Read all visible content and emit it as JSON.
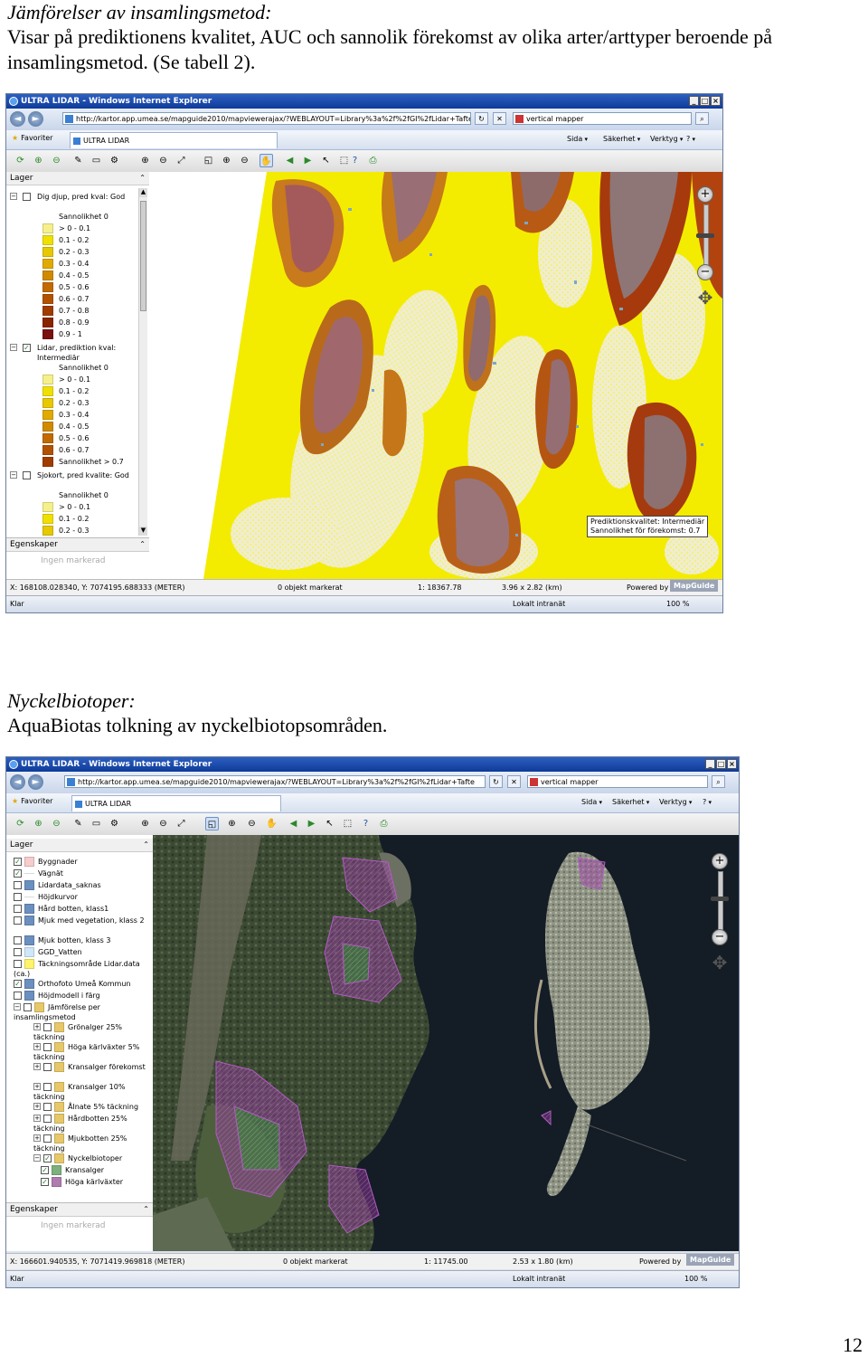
{
  "section1": {
    "heading": "Jämförelser av insamlingsmetod:",
    "line1": "Visar på prediktionens kvalitet, AUC och sannolik förekomst av olika arter/arttyper beroende på",
    "line2": "insamlingsmetod. (Se tabell 2)."
  },
  "section2": {
    "heading": "Nyckelbiotoper:",
    "line1": "AquaBiotas tolkning av nyckelbiotopsområden."
  },
  "page_number": "12",
  "screenshot1": {
    "window_title": "ULTRA LIDAR - Windows Internet Explorer",
    "url": "http://kartor.app.umea.se/mapguide2010/mapviewerajax/?WEBLAYOUT=Library%3a%2f%2fGI%2fLidar+Tafte",
    "search_value": "vertical mapper",
    "fav_label": "Favoriter",
    "tab_label": "ULTRA LIDAR",
    "cmd_sida": "Sida",
    "cmd_sakerhet": "Säkerhet",
    "cmd_verktyg": "Verktyg",
    "layers_title": "Lager",
    "props_title": "Egenskaper",
    "props_empty": "Ingen markerad",
    "groups": [
      {
        "title": "Dig djup, pred kval: God",
        "sub": "Sannolikhet 0",
        "items": [
          "> 0 - 0.1",
          "0.1 - 0.2",
          "0.2 - 0.3",
          "0.3 - 0.4",
          "0.4 - 0.5",
          "0.5 - 0.6",
          "0.6 - 0.7",
          "0.7 - 0.8",
          "0.8 - 0.9",
          "0.9 - 1"
        ]
      },
      {
        "title": "Lidar, prediktion kval: Intermediär",
        "sub": "Sannolikhet 0",
        "items": [
          "> 0 - 0.1",
          "0.1 - 0.2",
          "0.2 - 0.3",
          "0.3 - 0.4",
          "0.4 - 0.5",
          "0.5 - 0.6",
          "0.6 - 0.7",
          "Sannolikhet > 0.7"
        ]
      },
      {
        "title": "Sjokort, pred kvalite: God",
        "sub": "Sannolikhet 0",
        "items": [
          "> 0 - 0.1",
          "0.1 - 0.2",
          "0.2 - 0.3"
        ]
      }
    ],
    "info_line1": "Prediktionskvalitet: Intermediär",
    "info_line2": "Sannolikhet för förekomst: 0.7",
    "coords": "X: 168108.028340, Y: 7074195.688333 (METER)",
    "selected": "0 objekt markerat",
    "scale": "1: 18367.78",
    "extent": "3.96 x 2.82 (km)",
    "powered": "Powered by",
    "mapguide": "MapGuide",
    "status_left": "Klar",
    "zone": "Lokalt intranät",
    "zoom": "100 %",
    "legend_colors": [
      "#f5f08a",
      "#f0e000",
      "#e8c800",
      "#e0aa00",
      "#d08a00",
      "#c26a00",
      "#b25200",
      "#a03c00",
      "#8a2400",
      "#7a1010"
    ]
  },
  "screenshot2": {
    "window_title": "ULTRA LIDAR - Windows Internet Explorer",
    "url": "http://kartor.app.umea.se/mapguide2010/mapviewerajax/?WEBLAYOUT=Library%3a%2f%2fGI%2fLidar+Tafte",
    "search_value": "vertical mapper",
    "fav_label": "Favoriter",
    "tab_label": "ULTRA LIDAR",
    "cmd_sida": "Sida",
    "cmd_sakerhet": "Säkerhet",
    "cmd_verktyg": "Verktyg",
    "layers_title": "Lager",
    "props_title": "Egenskaper",
    "props_empty": "Ingen markerad",
    "layers": [
      {
        "label": "Byggnader",
        "checked": true,
        "swatch": "#f6cccc"
      },
      {
        "label": "Vägnät",
        "checked": true,
        "swatch": "line"
      },
      {
        "label": "Lidardata_saknas",
        "checked": false,
        "swatch": "icon"
      },
      {
        "label": "Höjdkurvor",
        "checked": false,
        "swatch": "line"
      },
      {
        "label": "Hård botten, klass1",
        "checked": false,
        "swatch": "icon"
      },
      {
        "label": "Mjuk med vegetation, klass 2",
        "checked": false,
        "swatch": "icon"
      },
      {
        "label": "Mjuk botten, klass 3",
        "checked": false,
        "swatch": "icon"
      },
      {
        "label": "GGD_Vatten",
        "checked": false,
        "swatch": "#cfe7fb"
      },
      {
        "label": "Täckningsområde Lidar.data (ca.)",
        "checked": false,
        "swatch": "#fff46a"
      },
      {
        "label": "Orthofoto Umeå Kommun",
        "checked": true,
        "swatch": "icon"
      },
      {
        "label": "Höjdmodell i färg",
        "checked": false,
        "swatch": "icon"
      },
      {
        "label": "Jämförelse per insamlingsmetod",
        "checked": false,
        "swatch": "folder"
      },
      {
        "label": "Grönalger 25% täckning",
        "checked": false,
        "swatch": "folder"
      },
      {
        "label": "Höga kärlväxter 5% täckning",
        "checked": false,
        "swatch": "folder"
      },
      {
        "label": "Kransalger förekomst",
        "checked": false,
        "swatch": "folder"
      },
      {
        "label": "Kransalger 10% täckning",
        "checked": false,
        "swatch": "folder"
      },
      {
        "label": "Ålnate 5% täckning",
        "checked": false,
        "swatch": "folder"
      },
      {
        "label": "Hårdbotten 25% täckning",
        "checked": false,
        "swatch": "folder"
      },
      {
        "label": "Mjukbotten 25% täckning",
        "checked": false,
        "swatch": "folder"
      },
      {
        "label": "Nyckelbiotoper",
        "checked": true,
        "swatch": "folder"
      },
      {
        "label": "Kransalger",
        "checked": true,
        "swatch": "#7cb07c"
      },
      {
        "label": "Höga kärlväxter",
        "checked": true,
        "swatch": "#b07cb0"
      }
    ],
    "coords": "X: 166601.940535, Y: 7071419.969818 (METER)",
    "selected": "0 objekt markerat",
    "scale": "1: 11745.00",
    "extent": "2.53 x 1.80 (km)",
    "powered": "Powered by",
    "mapguide": "MapGuide",
    "status_left": "Klar",
    "zone": "Lokalt intranät",
    "zoom": "100 %"
  }
}
